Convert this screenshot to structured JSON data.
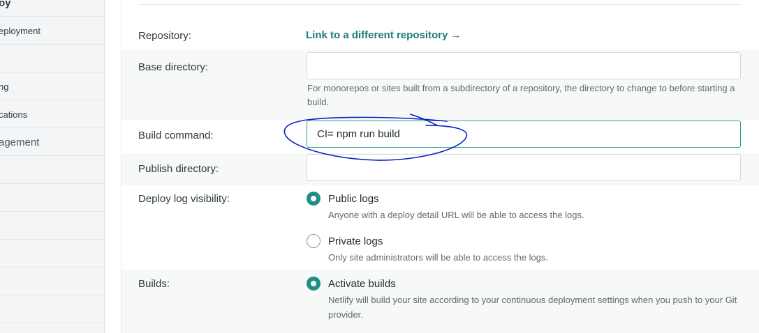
{
  "sidebar": {
    "title": "oy",
    "items": [
      {
        "label": "eployment"
      },
      {
        "label": ""
      },
      {
        "label": "ng"
      },
      {
        "label": "cations"
      },
      {
        "label": "agement"
      },
      {
        "label": ""
      },
      {
        "label": ""
      },
      {
        "label": ""
      },
      {
        "label": ""
      },
      {
        "label": ""
      },
      {
        "label": ""
      },
      {
        "label": ""
      }
    ]
  },
  "form": {
    "repository": {
      "label": "Repository:",
      "link": "Link to a different repository →"
    },
    "base_directory": {
      "label": "Base directory:",
      "value": "",
      "help": "For monorepos or sites built from a subdirectory of a repository, the directory to change to before starting a build."
    },
    "build_command": {
      "label": "Build command:",
      "value": "CI= npm run build"
    },
    "publish_directory": {
      "label": "Publish directory:",
      "value": ""
    },
    "deploy_log_visibility": {
      "label": "Deploy log visibility:",
      "options": [
        {
          "label": "Public logs",
          "description": "Anyone with a deploy detail URL will be able to access the logs.",
          "selected": true
        },
        {
          "label": "Private logs",
          "description": "Only site administrators will be able to access the logs.",
          "selected": false
        }
      ]
    },
    "builds": {
      "label": "Builds:",
      "options": [
        {
          "label": "Activate builds",
          "description": "Netlify will build your site according to your continuous deployment settings when you push to your Git provider.",
          "selected": true
        }
      ]
    }
  },
  "colors": {
    "accent": "#1f8f84",
    "link": "#1c7c76",
    "annotation": "#0a1fc8"
  }
}
